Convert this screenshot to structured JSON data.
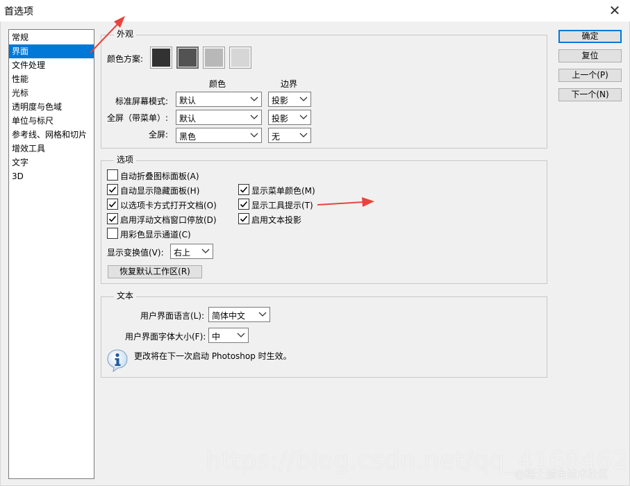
{
  "window": {
    "title": "首选项",
    "close_glyph": "✕"
  },
  "categories": [
    "常规",
    "界面",
    "文件处理",
    "性能",
    "光标",
    "透明度与色域",
    "单位与标尺",
    "参考线、网格和切片",
    "增效工具",
    "文字",
    "3D"
  ],
  "selected_category": "界面",
  "appearance": {
    "legend": "外观",
    "color_scheme_label": "颜色方案:",
    "swatches": [
      {
        "color": "#323232"
      },
      {
        "color": "#535353"
      },
      {
        "color": "#b8b8b8"
      },
      {
        "color": "#d6d6d6"
      }
    ],
    "selected_swatch": 2,
    "col_color": "颜色",
    "col_border": "边界",
    "rows": [
      {
        "label": "标准屏幕模式:",
        "color": "默认",
        "border": "投影"
      },
      {
        "label": "全屏（带菜单）:",
        "color": "默认",
        "border": "投影"
      },
      {
        "label": "全屏:",
        "color": "黑色",
        "border": "无"
      }
    ]
  },
  "options": {
    "legend": "选项",
    "left_checks": [
      {
        "label": "自动折叠图标面板(A)",
        "checked": false
      },
      {
        "label": "自动显示隐藏面板(H)",
        "checked": true
      },
      {
        "label": "以选项卡方式打开文档(O)",
        "checked": true
      },
      {
        "label": "启用浮动文档窗口停放(D)",
        "checked": true
      },
      {
        "label": "用彩色显示通道(C)",
        "checked": false
      }
    ],
    "right_checks": [
      {
        "label": "显示菜单颜色(M)",
        "checked": true
      },
      {
        "label": "显示工具提示(T)",
        "checked": true
      },
      {
        "label": "启用文本投影",
        "checked": true
      }
    ],
    "transform_label": "显示变换值(V):",
    "transform_value": "右上",
    "reset_button": "恢复默认工作区(R)"
  },
  "text_section": {
    "legend": "文本",
    "lang_label": "用户界面语言(L):",
    "lang_value": "简体中文",
    "font_size_label": "用户界面字体大小(F):",
    "font_size_value": "中",
    "info_note": "更改将在下一次启动 Photoshop 时生效。"
  },
  "buttons": {
    "ok": "确定",
    "reset": "复位",
    "prev": "上一个(P)",
    "next": "下一个(N)"
  },
  "watermark": {
    "url": "https://blog.csdn.net/qq_41684621",
    "brand": "@稀土掘金技术社区"
  },
  "colors": {
    "selection": "#0078d7",
    "annotation_arrow": "#e8433c"
  }
}
